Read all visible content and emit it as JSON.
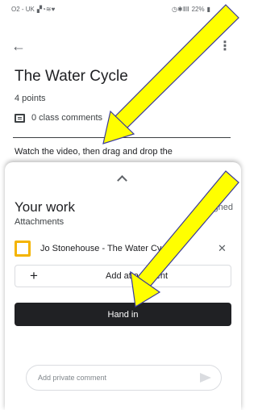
{
  "status_bar": {
    "left": "O2 - UK",
    "right": "22%"
  },
  "top_bar": {
    "back_icon": "arrow-back-icon",
    "more_icon": "more-vert-icon"
  },
  "assignment": {
    "title": "The Water Cycle",
    "points": "4 points",
    "comments": "0 class comments",
    "instructions": "Watch the video, then drag and drop the"
  },
  "your_work": {
    "heading": "Your work",
    "status": "Assigned",
    "attachments_label": "Attachments",
    "attachment": {
      "name": "Jo Stonehouse - The Water Cycle",
      "icon": "slides-icon"
    },
    "add_button_label": "Add attachment",
    "hand_in_label": "Hand in",
    "private_comment_placeholder": "Add private comment"
  },
  "colors": {
    "accent_dark": "#202124",
    "slides_yellow": "#f4b400",
    "arrow_yellow": "#ffff00"
  }
}
